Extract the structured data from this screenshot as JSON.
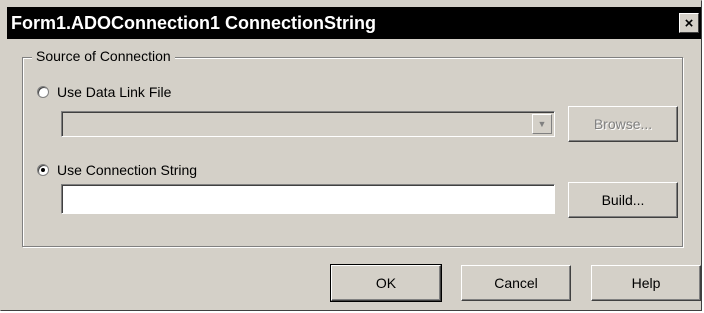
{
  "window": {
    "title": "Form1.ADOConnection1 ConnectionString",
    "close_label": "×"
  },
  "source_group": {
    "label": "Source of Connection",
    "data_link_file": {
      "label": "Use Data Link File",
      "selected": false,
      "combo_value": "",
      "browse_label": "Browse..."
    },
    "connection_string": {
      "label": "Use Connection String",
      "selected": true,
      "value": "",
      "build_label": "Build..."
    }
  },
  "footer": {
    "ok_label": "OK",
    "cancel_label": "Cancel",
    "help_label": "Help"
  }
}
